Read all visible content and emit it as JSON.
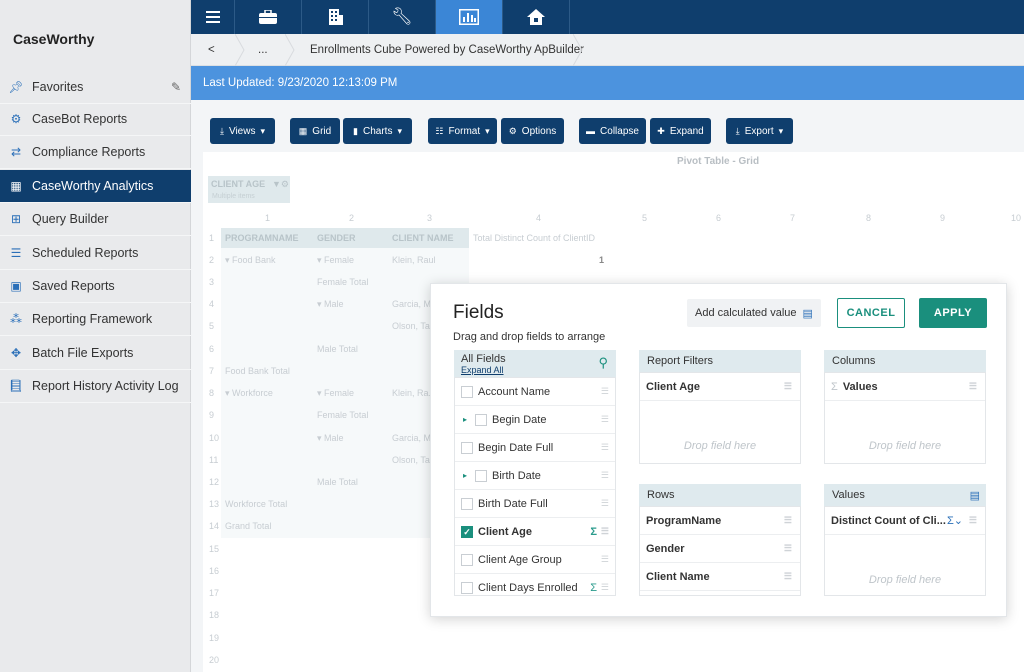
{
  "app": {
    "name": "CaseWorthy"
  },
  "sidebar": {
    "items": [
      {
        "label": "Favorites",
        "icon": "pin-icon"
      },
      {
        "label": "CaseBot Reports",
        "icon": "casebot-icon"
      },
      {
        "label": "Compliance Reports",
        "icon": "compliance-icon"
      },
      {
        "label": "CaseWorthy Analytics",
        "icon": "table-icon",
        "active": true
      },
      {
        "label": "Query Builder",
        "icon": "query-icon"
      },
      {
        "label": "Scheduled Reports",
        "icon": "list-icon"
      },
      {
        "label": "Saved Reports",
        "icon": "save-icon"
      },
      {
        "label": "Reporting Framework",
        "icon": "hierarchy-icon"
      },
      {
        "label": "Batch File Exports",
        "icon": "export-icon"
      },
      {
        "label": "Report History Activity Log",
        "icon": "book-icon"
      }
    ]
  },
  "topnav": {
    "icons": [
      "menu-icon",
      "briefcase-icon",
      "building-icon",
      "wrench-icon",
      "analytics-icon",
      "home-icon"
    ],
    "active": "analytics-icon"
  },
  "breadcrumb": {
    "back": "<",
    "ellipsis": "...",
    "title": "Enrollments Cube Powered by CaseWorthy ApBuilder"
  },
  "status": {
    "last_updated": "Last Updated: 9/23/2020 12:13:09 PM"
  },
  "toolbar": {
    "views": "Views",
    "grid": "Grid",
    "charts": "Charts",
    "format": "Format",
    "options": "Options",
    "collapse": "Collapse",
    "expand": "Expand",
    "export": "Export"
  },
  "pivot": {
    "title": "Pivot Table - Grid",
    "filter_chip": {
      "label": "CLIENT AGE",
      "sub": "Multiple items"
    },
    "col_numbers": [
      "1",
      "2",
      "3",
      "4",
      "5",
      "6",
      "7",
      "8",
      "9",
      "10"
    ],
    "headers": [
      "PROGRAMNAME",
      "GENDER",
      "CLIENT NAME",
      "Total Distinct Count of ClientID"
    ],
    "row_numbers": [
      "1",
      "2",
      "3",
      "4",
      "5",
      "6",
      "7",
      "8",
      "9",
      "10",
      "11",
      "12",
      "13",
      "14",
      "15",
      "16",
      "17",
      "18",
      "19",
      "20"
    ],
    "rows": [
      {
        "n": "2",
        "a": "▾ Food Bank",
        "b": "▾ Female",
        "c": "Klein, Raul",
        "d": "1"
      },
      {
        "n": "3",
        "a": "",
        "b": "Female Total",
        "c": "",
        "d": ""
      },
      {
        "n": "4",
        "a": "",
        "b": "▾ Male",
        "c": "Garcia, Ma...",
        "d": ""
      },
      {
        "n": "5",
        "a": "",
        "b": "",
        "c": "Olson, Ta...",
        "d": ""
      },
      {
        "n": "6",
        "a": "",
        "b": "Male Total",
        "c": "",
        "d": ""
      },
      {
        "n": "7",
        "a": "Food Bank Total",
        "b": "",
        "c": "",
        "d": ""
      },
      {
        "n": "8",
        "a": "▾ Workforce",
        "b": "▾ Female",
        "c": "Klein, Ra...",
        "d": ""
      },
      {
        "n": "9",
        "a": "",
        "b": "Female Total",
        "c": "",
        "d": ""
      },
      {
        "n": "10",
        "a": "",
        "b": "▾ Male",
        "c": "Garcia, Ma...",
        "d": ""
      },
      {
        "n": "11",
        "a": "",
        "b": "",
        "c": "Olson, Ta...",
        "d": ""
      },
      {
        "n": "12",
        "a": "",
        "b": "Male Total",
        "c": "",
        "d": ""
      },
      {
        "n": "13",
        "a": "Workforce Total",
        "b": "",
        "c": "",
        "d": ""
      },
      {
        "n": "14",
        "a": "Grand Total",
        "b": "",
        "c": "",
        "d": ""
      }
    ]
  },
  "fields_dialog": {
    "title": "Fields",
    "subtitle": "Drag and drop fields to arrange",
    "add_calc": "Add calculated value",
    "cancel": "CANCEL",
    "apply": "APPLY",
    "all_fields": "All Fields",
    "expand_all": "Expand All",
    "fields": [
      {
        "label": "Account Name",
        "checked": false,
        "expandable": false,
        "sigma": false
      },
      {
        "label": "Begin Date",
        "checked": false,
        "expandable": true,
        "sigma": false
      },
      {
        "label": "Begin Date Full",
        "checked": false,
        "expandable": false,
        "sigma": false
      },
      {
        "label": "Birth Date",
        "checked": false,
        "expandable": true,
        "sigma": false
      },
      {
        "label": "Birth Date Full",
        "checked": false,
        "expandable": false,
        "sigma": false
      },
      {
        "label": "Client Age",
        "checked": true,
        "expandable": false,
        "sigma": true
      },
      {
        "label": "Client Age Group",
        "checked": false,
        "expandable": false,
        "sigma": false
      },
      {
        "label": "Client Days Enrolled",
        "checked": false,
        "expandable": false,
        "sigma": true
      }
    ],
    "report_filters": {
      "label": "Report Filters",
      "items": [
        "Client Age"
      ],
      "drop": "Drop field here"
    },
    "columns": {
      "label": "Columns",
      "items": [
        "Values"
      ],
      "drop": "Drop field here"
    },
    "rows": {
      "label": "Rows",
      "items": [
        "ProgramName",
        "Gender",
        "Client Name"
      ]
    },
    "values": {
      "label": "Values",
      "items": [
        "Distinct Count of Cli..."
      ],
      "drop": "Drop field here"
    }
  },
  "colors": {
    "navy": "#0f3e6d",
    "blue": "#4c93de",
    "teal": "#1a8f7d"
  }
}
